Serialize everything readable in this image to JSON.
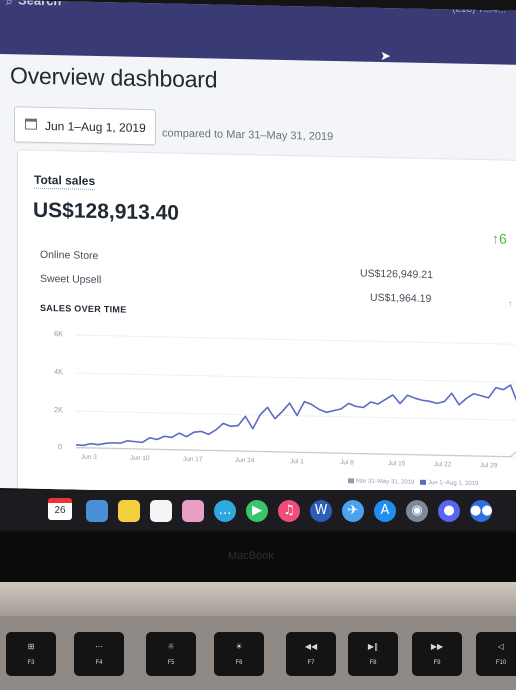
{
  "topbar": {
    "search_label": "Search",
    "store_label": "(218) 7...4..."
  },
  "page": {
    "title": "Overview dashboard",
    "date_range": "Jun 1–Aug 1, 2019",
    "compare_text": "compared to Mar 31–May 31, 2019"
  },
  "card": {
    "title": "Total sales",
    "total": "US$128,913.40",
    "change": "↑6",
    "rows": [
      {
        "label": "Online Store",
        "value": "US$126,949.21"
      },
      {
        "label": "Sweet Upsell",
        "value": "US$1,964.19"
      }
    ],
    "section_heading": "SALES OVER TIME"
  },
  "chart_data": {
    "type": "line",
    "title": "SALES OVER TIME",
    "x_ticks": [
      "Jun 3",
      "Jun 10",
      "Jun 17",
      "Jun 24",
      "Jul 1",
      "Jul 8",
      "Jul 15",
      "Jul 22",
      "Jul 29"
    ],
    "y_ticks": [
      "6K",
      "4K",
      "2K",
      "0"
    ],
    "ylim": [
      0,
      6000
    ],
    "grid": true,
    "legend_position": "bottom-right",
    "series": [
      {
        "name": "Mar 31–May 31, 2019",
        "color": "#c4cdd5",
        "values": [
          0,
          0,
          0,
          0,
          0,
          0,
          0,
          0,
          0,
          0,
          0,
          0,
          0,
          0,
          0,
          0,
          0,
          0,
          0,
          0,
          0,
          0,
          0,
          0,
          0,
          0,
          0,
          0,
          0,
          0,
          0,
          0,
          0,
          0,
          0,
          0,
          0,
          0,
          0,
          0,
          0,
          0,
          0,
          0,
          0,
          0,
          0,
          0,
          0,
          0,
          0,
          0,
          0,
          0,
          0,
          0,
          0,
          0,
          0,
          0,
          350
        ]
      },
      {
        "name": "Jun 1–Aug 1, 2019",
        "color": "#5c6ac4",
        "values": [
          150,
          120,
          230,
          180,
          260,
          300,
          280,
          420,
          380,
          350,
          600,
          520,
          700,
          650,
          880,
          700,
          950,
          1000,
          850,
          1100,
          1450,
          1300,
          1350,
          1850,
          1200,
          1950,
          2350,
          1750,
          2150,
          2600,
          1950,
          2700,
          2550,
          2300,
          2150,
          2250,
          2350,
          2650,
          2500,
          2450,
          2750,
          2650,
          2900,
          3150,
          2700,
          3150,
          3000,
          2900,
          2850,
          2750,
          2850,
          3300,
          2700,
          3050,
          3300,
          3200,
          3100,
          3650,
          3550,
          3800,
          2800
        ]
      }
    ]
  },
  "dock": {
    "calendar_day": "26",
    "apps": [
      {
        "name": "finder-icon",
        "color": "#4a90d9",
        "glyph": ""
      },
      {
        "name": "notes-icon",
        "color": "#f4d03f",
        "glyph": ""
      },
      {
        "name": "textedit-icon",
        "color": "#f5f5f5",
        "glyph": ""
      },
      {
        "name": "photos-icon",
        "color": "#e7a0c4",
        "glyph": ""
      },
      {
        "name": "messages-icon",
        "color": "#2fa8e0",
        "glyph": "…"
      },
      {
        "name": "facetime-icon",
        "color": "#3cc46b",
        "glyph": "▶"
      },
      {
        "name": "music-icon",
        "color": "#f14d7a",
        "glyph": "♫"
      },
      {
        "name": "word-icon",
        "color": "#2b5eb6",
        "glyph": "W"
      },
      {
        "name": "mail-icon",
        "color": "#4aa3f0",
        "glyph": "✈"
      },
      {
        "name": "app-store-icon",
        "color": "#1f8ef1",
        "glyph": "A"
      },
      {
        "name": "preview-icon",
        "color": "#7b8a9a",
        "glyph": "◉"
      },
      {
        "name": "discord-icon",
        "color": "#5865f2",
        "glyph": "●"
      },
      {
        "name": "shortcut-icon",
        "color": "#2f6fe0",
        "glyph": "●●"
      }
    ]
  },
  "laptop": {
    "brand": "MacBook",
    "keys": [
      {
        "glyph": "⊞",
        "label": "F3"
      },
      {
        "glyph": "⋯",
        "label": "F4"
      },
      {
        "glyph": "☼",
        "label": "F5"
      },
      {
        "glyph": "☀",
        "label": "F6"
      },
      {
        "glyph": "◀◀",
        "label": "F7"
      },
      {
        "glyph": "▶‖",
        "label": "F8"
      },
      {
        "glyph": "▶▶",
        "label": "F9"
      },
      {
        "glyph": "◁",
        "label": "F10"
      }
    ]
  },
  "colors": {
    "topbar": "#3a3a74",
    "accent": "#5c6ac4",
    "positive": "#50b83c"
  }
}
